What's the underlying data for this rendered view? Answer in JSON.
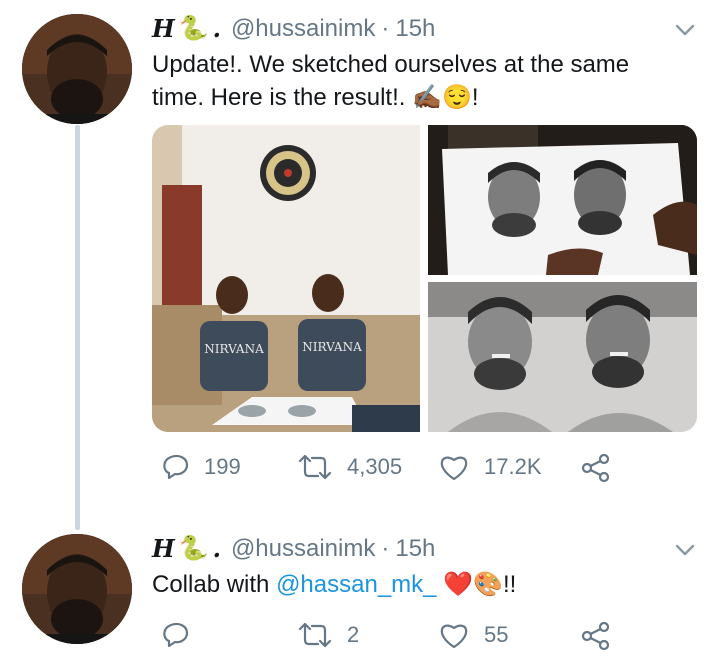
{
  "tweets": [
    {
      "author": {
        "name": "H",
        "name_suffix": ".",
        "emoji": "🐍",
        "handle": "@hussainimk",
        "separator": "·",
        "time": "15h"
      },
      "text_line1": "Update!. We sketched ourselves at the same",
      "text_line2": "time. Here is the result!.",
      "text_emojis": "✍🏾😌",
      "text_end": "!",
      "actions": {
        "replies": "199",
        "retweets": "4,305",
        "likes": "17.2K"
      }
    },
    {
      "author": {
        "name": "H",
        "name_suffix": ".",
        "emoji": "🐍",
        "handle": "@hussainimk",
        "separator": "·",
        "time": "15h"
      },
      "text_prefix": "Collab with ",
      "mention": "@hassan_mk_",
      "text_emojis": "❤️🎨",
      "text_end": "!!",
      "actions": {
        "replies": "",
        "retweets": "2",
        "likes": "55"
      }
    }
  ],
  "media": {
    "photo_shirt_text": "NIRVANA"
  },
  "colors": {
    "accent": "#1b95e0",
    "muted": "#657786",
    "text": "#14171a",
    "thread": "#ccd6dd"
  }
}
